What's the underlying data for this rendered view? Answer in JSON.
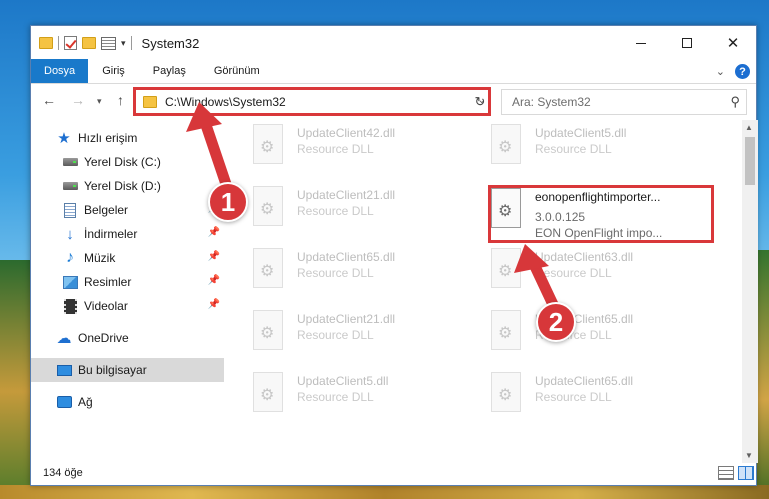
{
  "window": {
    "title": "System32"
  },
  "ribbon": {
    "tabs": [
      "Dosya",
      "Giriş",
      "Paylaş",
      "Görünüm"
    ],
    "help_label": "?"
  },
  "nav": {
    "address": "C:\\Windows\\System32",
    "search_placeholder": "Ara: System32"
  },
  "sidebar": {
    "items": [
      {
        "label": "Hızlı erişim",
        "icon": "star-icon"
      },
      {
        "label": "Yerel Disk (C:)",
        "icon": "drive-icon"
      },
      {
        "label": "Yerel Disk (D:)",
        "icon": "drive-icon"
      },
      {
        "label": "Belgeler",
        "icon": "documents-icon"
      },
      {
        "label": "İndirmeler",
        "icon": "download-icon"
      },
      {
        "label": "Müzik",
        "icon": "music-icon"
      },
      {
        "label": "Resimler",
        "icon": "pictures-icon"
      },
      {
        "label": "Videolar",
        "icon": "videos-icon"
      },
      {
        "label": "OneDrive",
        "icon": "cloud-icon"
      },
      {
        "label": "Bu bilgisayar",
        "icon": "computer-icon"
      },
      {
        "label": "Ağ",
        "icon": "network-icon"
      }
    ]
  },
  "files": [
    {
      "name": "UpdateClient42.dll",
      "type": "Resource DLL"
    },
    {
      "name": "UpdateClient5.dll",
      "type": "Resource DLL"
    },
    {
      "name": "UpdateClient21.dll",
      "type": "Resource DLL"
    },
    {
      "name": "eonopenflightimporter...",
      "version": "3.0.0.125",
      "description": "EON OpenFlight impo..."
    },
    {
      "name": "UpdateClient65.dll",
      "type": "Resource DLL"
    },
    {
      "name": "UpdateClient63.dll",
      "type": "Resource DLL"
    },
    {
      "name": "UpdateClient21.dll",
      "type": "Resource DLL"
    },
    {
      "name": "UpdateClient65.dll",
      "type": "Resource DLL"
    },
    {
      "name": "UpdateClient5.dll",
      "type": "Resource DLL"
    },
    {
      "name": "UpdateClient65.dll",
      "type": "Resource DLL"
    }
  ],
  "status": {
    "item_count": "134 öğe"
  },
  "annotations": {
    "badge1": "1",
    "badge2": "2"
  },
  "colors": {
    "accent": "#1979ca",
    "highlight": "#d9383a"
  }
}
